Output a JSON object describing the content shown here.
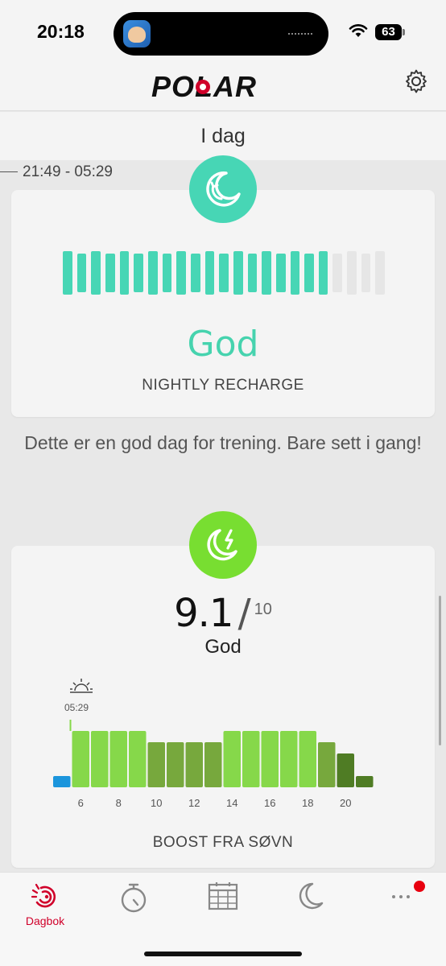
{
  "status_bar": {
    "time": "20:18",
    "battery": "63"
  },
  "header": {
    "brand": "POLAR"
  },
  "date_bar": {
    "label": "I dag"
  },
  "sleep": {
    "time_range": "21:49 - 05:29"
  },
  "nightly_recharge": {
    "status": "God",
    "label": "NIGHTLY RECHARGE",
    "bars_filled": 19,
    "bars_total": 23,
    "color": "#47d6b5"
  },
  "advice": "Dette er en god dag for trening. Bare sett i gang!",
  "boost": {
    "score": "9.1",
    "separator": "/",
    "max": "10",
    "status": "God",
    "wake_time": "05:29",
    "label": "BOOST FRA SØVN",
    "accent": "#78de31"
  },
  "chart_data": {
    "type": "bar",
    "x_ticks": [
      "6",
      "8",
      "10",
      "12",
      "14",
      "16",
      "18",
      "20"
    ],
    "hours": [
      5,
      6,
      7,
      8,
      9,
      10,
      11,
      12,
      13,
      14,
      15,
      16,
      17,
      18,
      19,
      20,
      21
    ],
    "values": [
      1,
      5,
      5,
      5,
      5,
      4,
      4,
      4,
      4,
      5,
      5,
      5,
      5,
      5,
      4,
      3,
      1
    ],
    "colors": [
      "#1b95dc",
      "#86d84a",
      "#86d84a",
      "#86d84a",
      "#86d84a",
      "#77a83d",
      "#77a83d",
      "#77a83d",
      "#77a83d",
      "#86d84a",
      "#86d84a",
      "#86d84a",
      "#86d84a",
      "#86d84a",
      "#77a83d",
      "#4f7c24",
      "#4f7c24"
    ],
    "ylim": [
      0,
      6
    ],
    "wake_marker_hour": 5.5
  },
  "tabs": [
    {
      "label": "Dagbok",
      "icon": "diary-icon",
      "active": true
    },
    {
      "label": "",
      "icon": "stopwatch-icon",
      "active": false
    },
    {
      "label": "",
      "icon": "calendar-icon",
      "active": false
    },
    {
      "label": "",
      "icon": "moon-icon",
      "active": false
    },
    {
      "label": "",
      "icon": "more-icon",
      "active": false
    }
  ]
}
